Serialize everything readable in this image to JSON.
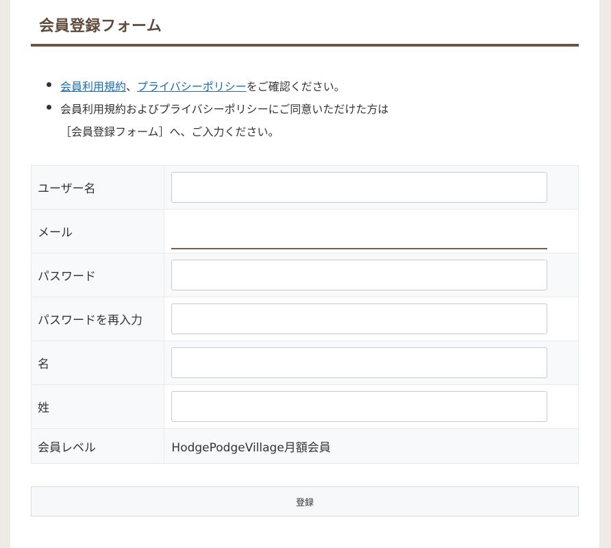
{
  "form_title": "会員登録フォーム",
  "notice": {
    "terms_link": "会員利用規約",
    "separator": "、",
    "privacy_link": "プライバシーポリシー",
    "confirm_text": "をご確認ください。",
    "agree_line1": "会員利用規約およびプライバシーポリシーにご同意いただけた方は",
    "agree_line2": "［会員登録フォーム］へ、ご入力ください。"
  },
  "fields": {
    "username": {
      "label": "ユーザー名",
      "value": ""
    },
    "email": {
      "label": "メール",
      "value": ""
    },
    "password": {
      "label": "パスワード",
      "value": ""
    },
    "password_confirm": {
      "label": "パスワードを再入力",
      "value": ""
    },
    "first_name": {
      "label": "名",
      "value": ""
    },
    "last_name": {
      "label": "姓",
      "value": ""
    },
    "membership_level": {
      "label": "会員レベル",
      "value": "HodgePodgeVillage月額会員"
    }
  },
  "submit_label": "登録",
  "colors": {
    "page_background": "#eeeae6",
    "title_text": "#5e4a3c",
    "title_rule": "#6b5244",
    "link": "#1a6bb5",
    "email_underline": "#7a5c4d"
  }
}
